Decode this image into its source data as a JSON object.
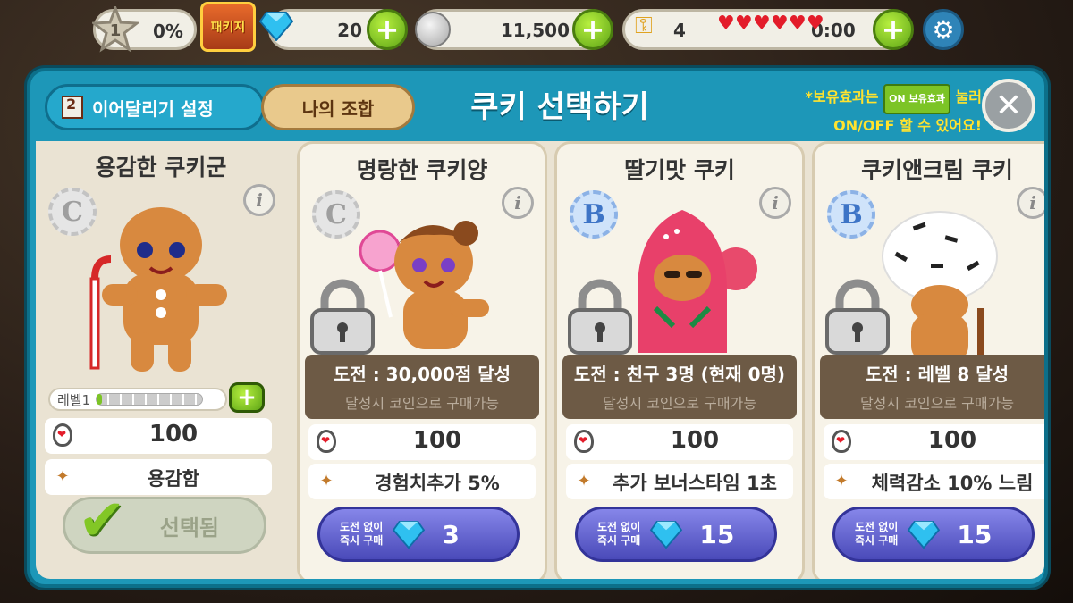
{
  "hud": {
    "level": "1",
    "exp_percent": "0%",
    "package_label": "패키지",
    "gems": "20",
    "coins": "11,500",
    "keys": "4",
    "hearts_count": 6,
    "timer": "0:00",
    "icons": {
      "level": "star-icon",
      "gems": "gem-icon",
      "coins": "coin-icon",
      "keys": "key-icon",
      "hearts": "heart-icon",
      "settings": "gear-icon"
    }
  },
  "panel": {
    "relay_button": "이어달리기 설정",
    "combo_button": "나의 조합",
    "title": "쿠키 선택하기",
    "tip_prefix": "*보유효과는",
    "tip_badge_top": "ON",
    "tip_badge": "보유효과",
    "tip_mid": "눌러",
    "tip_line2": "ON/OFF 할 수 있어요!"
  },
  "cards": [
    {
      "name": "용감한 쿠키군",
      "grade": "C",
      "hp": "100",
      "effect": "용감함",
      "level_label": "레벨1",
      "level_progress": 0.05,
      "selected_label": "선택됨"
    },
    {
      "name": "명랑한 쿠키양",
      "grade": "C",
      "challenge": "도전 : 30,000점 달성",
      "challenge_note": "달성시 코인으로 구매가능",
      "hp": "100",
      "effect": "경험치추가 5%",
      "buy_line1": "도전 없이",
      "buy_line2": "즉시 구매",
      "price": "3"
    },
    {
      "name": "딸기맛 쿠키",
      "grade": "B",
      "challenge": "도전 : 친구 3명 (현재 0명)",
      "challenge_note": "달성시 코인으로 구매가능",
      "hp": "100",
      "effect": "추가 보너스타임 1초",
      "buy_line1": "도전 없이",
      "buy_line2": "즉시 구매",
      "price": "15"
    },
    {
      "name": "쿠키앤크림 쿠키",
      "grade": "B",
      "challenge": "도전 : 레벨 8 달성",
      "challenge_note": "달성시 코인으로 구매가능",
      "hp": "100",
      "effect": "체력감소 10% 느림",
      "buy_line1": "도전 없이",
      "buy_line2": "즉시 구매",
      "price": "15"
    }
  ],
  "colors": {
    "panel": "#1d97b8",
    "accent_green": "#7cc426",
    "buy_purple": "#5a5ad0",
    "heart_red": "#e31c2a"
  }
}
